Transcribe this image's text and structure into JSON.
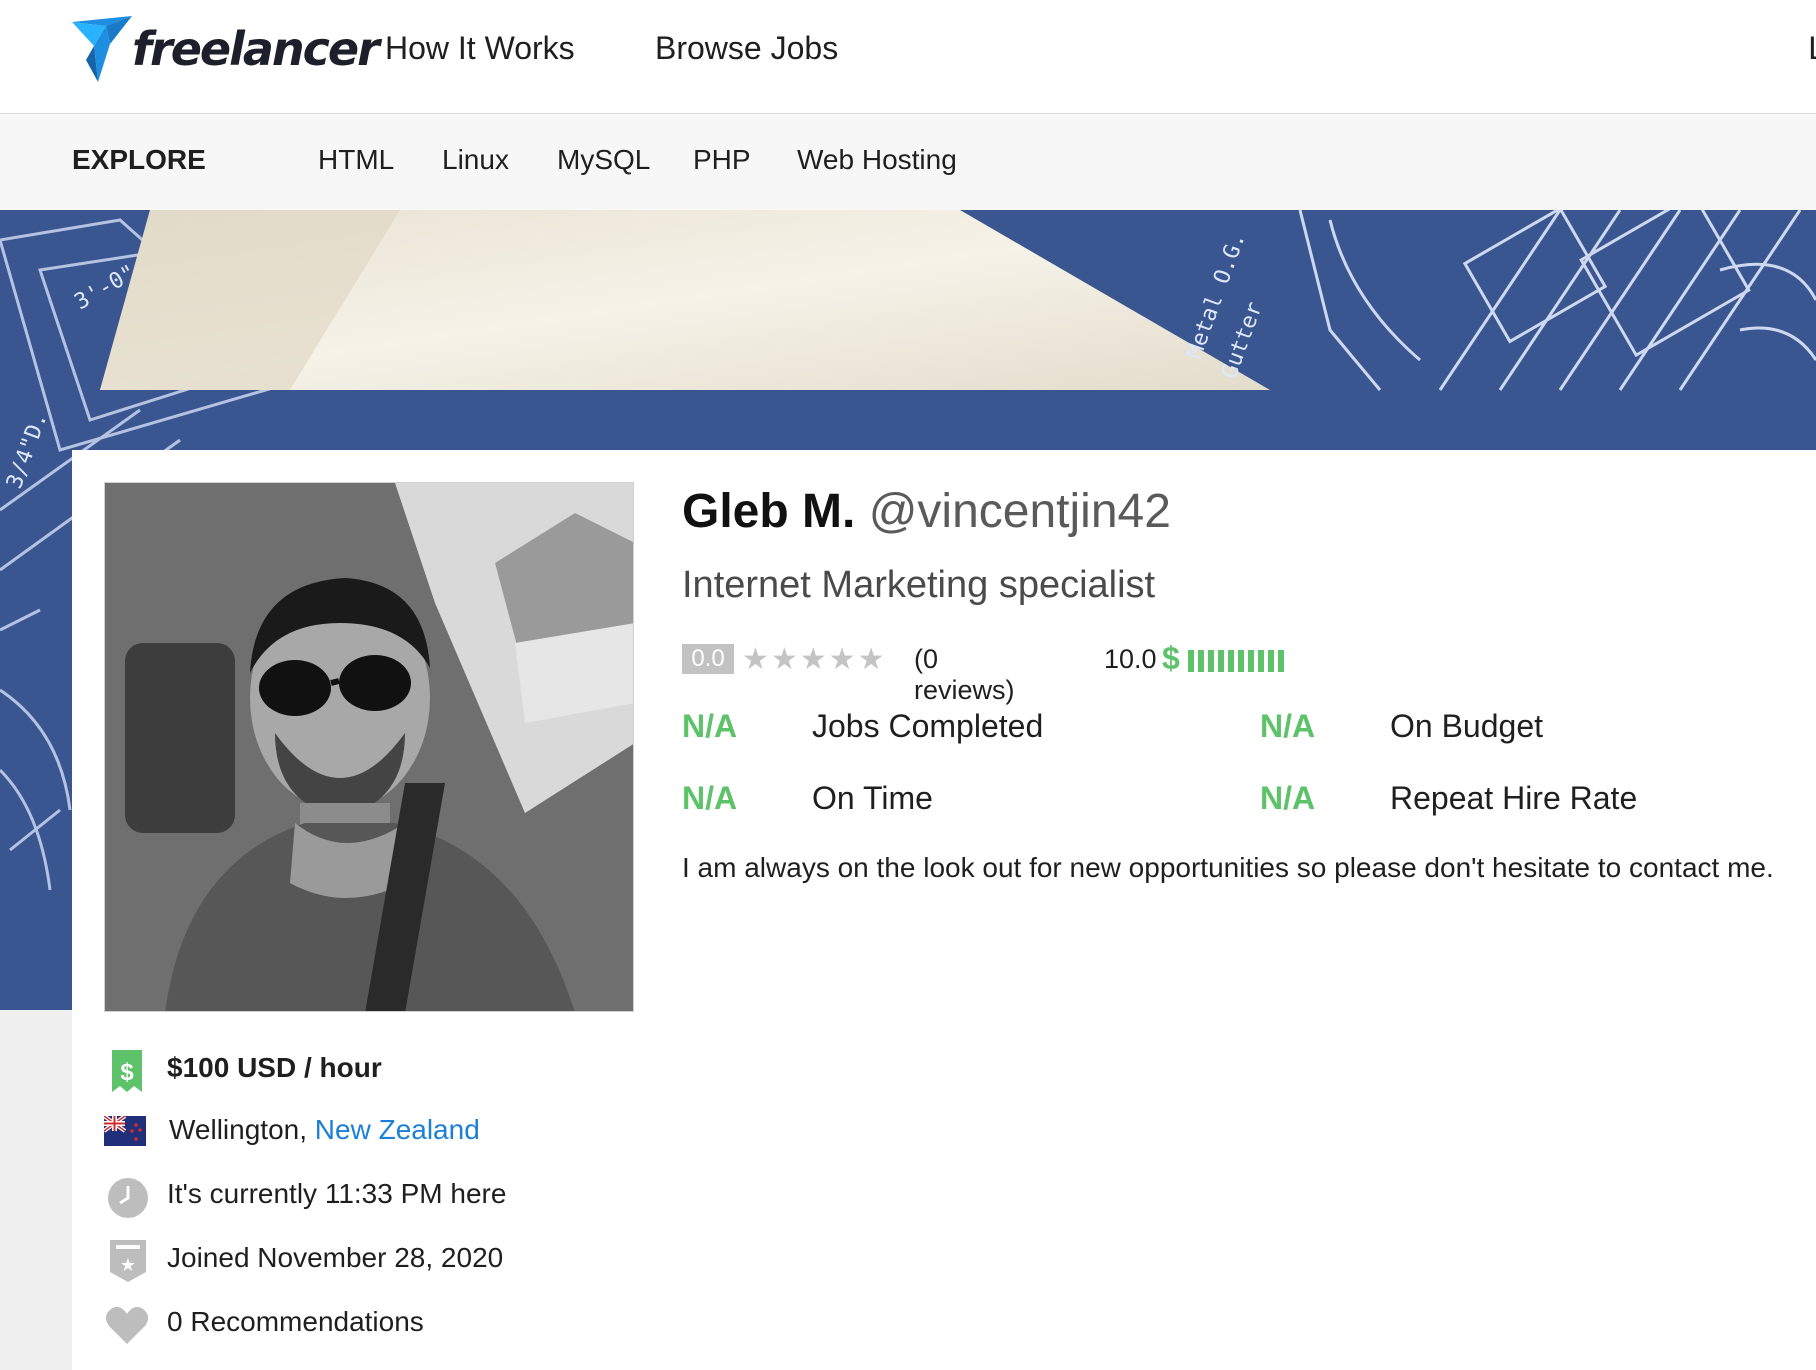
{
  "header": {
    "logo_text": "freelancer",
    "nav": [
      "How It Works",
      "Browse Jobs"
    ],
    "nav_cut_char": "L"
  },
  "explore": {
    "label": "EXPLORE",
    "links": [
      "HTML",
      "Linux",
      "MySQL",
      "PHP",
      "Web Hosting"
    ]
  },
  "banner": {
    "text_metal": "Metal O.G.",
    "text_gutter": "Gutter",
    "text_dim1": "3'-0\"",
    "text_dim2": "3/4",
    "text_dim3": "3/4\"D."
  },
  "profile": {
    "name": "Gleb M.",
    "username": "@vincentjin42",
    "tagline": "Internet Marketing specialist",
    "rating": "0.0",
    "stars": "★★★★★",
    "reviews": "(0 reviews)",
    "earnings_score": "10.0",
    "earnings_symbol": "$",
    "earnings_level": 1.0,
    "stats": [
      {
        "value": "N/A",
        "label": "Jobs Completed"
      },
      {
        "value": "N/A",
        "label": "On Budget"
      },
      {
        "value": "N/A",
        "label": "On Time"
      },
      {
        "value": "N/A",
        "label": "Repeat Hire Rate"
      }
    ],
    "bio": "I am always on the look out for new opportunities so please don't hesitate to contact me."
  },
  "details": {
    "rate": "$100 USD / hour",
    "city": "Wellington, ",
    "country": "New Zealand",
    "local_time": "It's currently 11:33 PM here",
    "joined": "Joined November 28, 2020",
    "recommendations": "0 Recommendations"
  },
  "colors": {
    "accent_green": "#5dc26a",
    "link_blue": "#1c7fd7",
    "logo_blue": "#29b2fe",
    "banner_blue": "#344f86"
  }
}
